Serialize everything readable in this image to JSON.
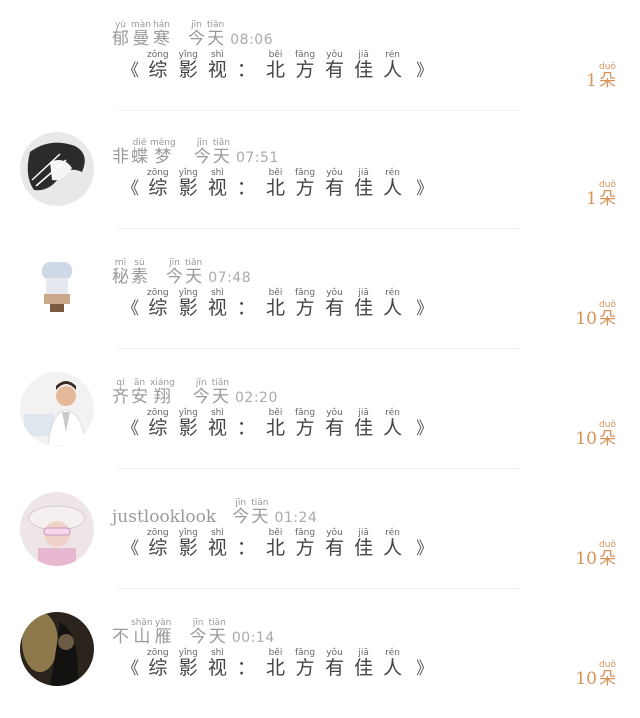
{
  "rows": [
    {
      "name": [
        {
          "py": "yù",
          "ch": "郁"
        },
        {
          "py": "màn",
          "ch": "曼"
        },
        {
          "py": "hán",
          "ch": "寒"
        }
      ],
      "time_prefix": [
        {
          "py": "jīn",
          "ch": "今"
        },
        {
          "py": "tiān",
          "ch": "天"
        }
      ],
      "time": "08:06",
      "count": "1",
      "avatar": "none"
    },
    {
      "name": [
        {
          "py": "",
          "ch": "非"
        },
        {
          "py": "dié",
          "ch": "蝶"
        },
        {
          "py": "mèng",
          "ch": "梦"
        }
      ],
      "time_prefix": [
        {
          "py": "jīn",
          "ch": "今"
        },
        {
          "py": "tiān",
          "ch": "天"
        }
      ],
      "time": "07:51",
      "count": "1",
      "avatar": "sketch"
    },
    {
      "name": [
        {
          "py": "mì",
          "ch": "秘"
        },
        {
          "py": "sù",
          "ch": "素"
        }
      ],
      "time_prefix": [
        {
          "py": "jīn",
          "ch": "今"
        },
        {
          "py": "tiān",
          "ch": "天"
        }
      ],
      "time": "07:48",
      "count": "10",
      "avatar": "bust"
    },
    {
      "name": [
        {
          "py": "qí",
          "ch": "齐"
        },
        {
          "py": "ān",
          "ch": "安"
        },
        {
          "py": "xiáng",
          "ch": "翔"
        }
      ],
      "time_prefix": [
        {
          "py": "jīn",
          "ch": "今"
        },
        {
          "py": "tiān",
          "ch": "天"
        }
      ],
      "time": "02:20",
      "count": "10",
      "avatar": "man"
    },
    {
      "name_plain": "justlooklook",
      "time_prefix": [
        {
          "py": "jīn",
          "ch": "今"
        },
        {
          "py": "tiān",
          "ch": "天"
        }
      ],
      "time": "01:24",
      "count": "10",
      "avatar": "hat"
    },
    {
      "name": [
        {
          "py": "",
          "ch": "不"
        },
        {
          "py": "shān",
          "ch": "山"
        },
        {
          "py": "yàn",
          "ch": "雁"
        }
      ],
      "time_prefix": [
        {
          "py": "jīn",
          "ch": "今"
        },
        {
          "py": "tiān",
          "ch": "天"
        }
      ],
      "time": "00:14",
      "count": "10",
      "avatar": "dark"
    }
  ],
  "title": {
    "open": "《",
    "close": "》",
    "chars": [
      {
        "py": "zōng",
        "ch": "综"
      },
      {
        "py": "yǐng",
        "ch": "影"
      },
      {
        "py": "shì",
        "ch": "视"
      },
      {
        "py": "",
        "ch": "："
      },
      {
        "py": "běi",
        "ch": "北"
      },
      {
        "py": "fāng",
        "ch": "方"
      },
      {
        "py": "yǒu",
        "ch": "有"
      },
      {
        "py": "jiā",
        "ch": "佳"
      },
      {
        "py": "rén",
        "ch": "人"
      }
    ]
  },
  "unit": {
    "py": "duǒ",
    "ch": "朵"
  },
  "colors": {
    "count": "#d6935a",
    "divider": "#efefef"
  }
}
